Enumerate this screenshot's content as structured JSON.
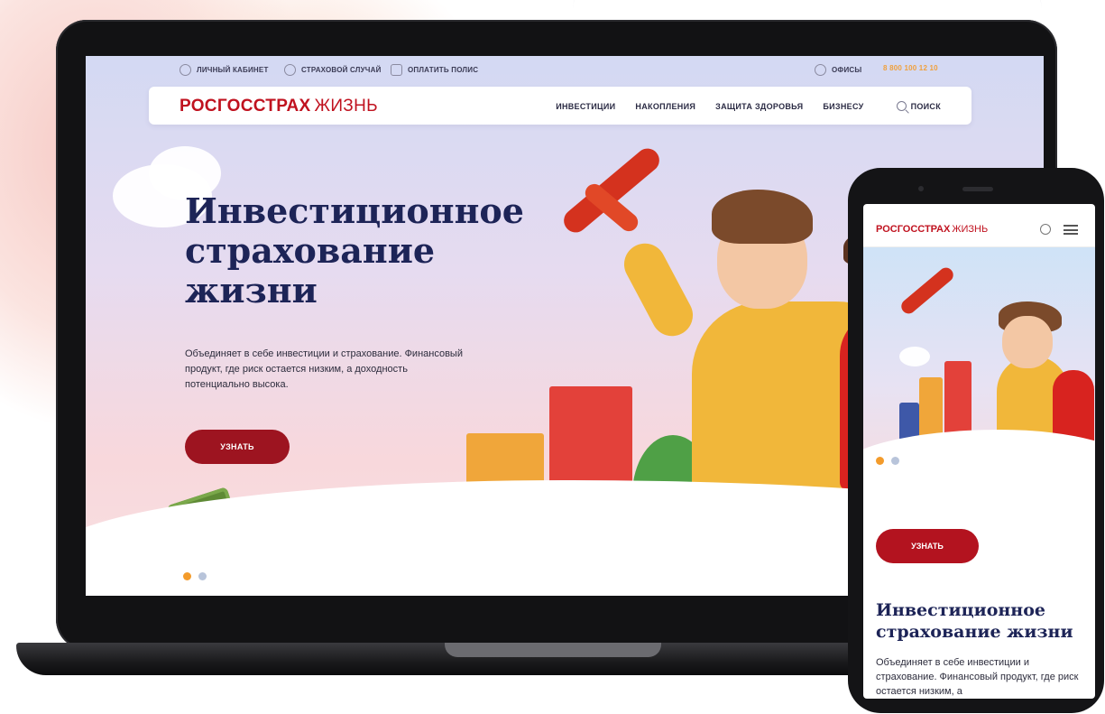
{
  "topbar": {
    "cabinet": "ЛИЧНЫЙ КАБИНЕТ",
    "insurance_case": "СТРАХОВОЙ СЛУЧАЙ",
    "pay_policy": "ОПЛАТИТЬ ПОЛИС",
    "offices": "ОФИСЫ",
    "phone": "8 800 100 12 10"
  },
  "brand": {
    "name": "РОСГОССТРАХ",
    "suffix": "ЖИЗНЬ",
    "color": "#c0121f"
  },
  "nav": {
    "items": [
      "ИНВЕСТИЦИИ",
      "НАКОПЛЕНИЯ",
      "ЗАЩИТА ЗДОРОВЬЯ",
      "БИЗНЕСУ"
    ],
    "search_label": "ПОИСК"
  },
  "hero": {
    "title": "Инвестиционное страхование жизни",
    "description": "Объединяет в себе инвестиции и страхование. Финансовый продукт, где риск остается низким, а доходность потенциально высока.",
    "button": "УЗНАТЬ",
    "active_slide": 1,
    "slide_count": 2
  },
  "mobile": {
    "title": "Инвестиционное страхование жизни",
    "description": "Объединяет в себе инвестиции и страхование. Финансовый продукт, где риск остается низким, а",
    "button": "УЗНАТЬ"
  },
  "colors": {
    "accent": "#9d1420",
    "dot_active": "#f39b2b",
    "title": "#1d2457"
  }
}
